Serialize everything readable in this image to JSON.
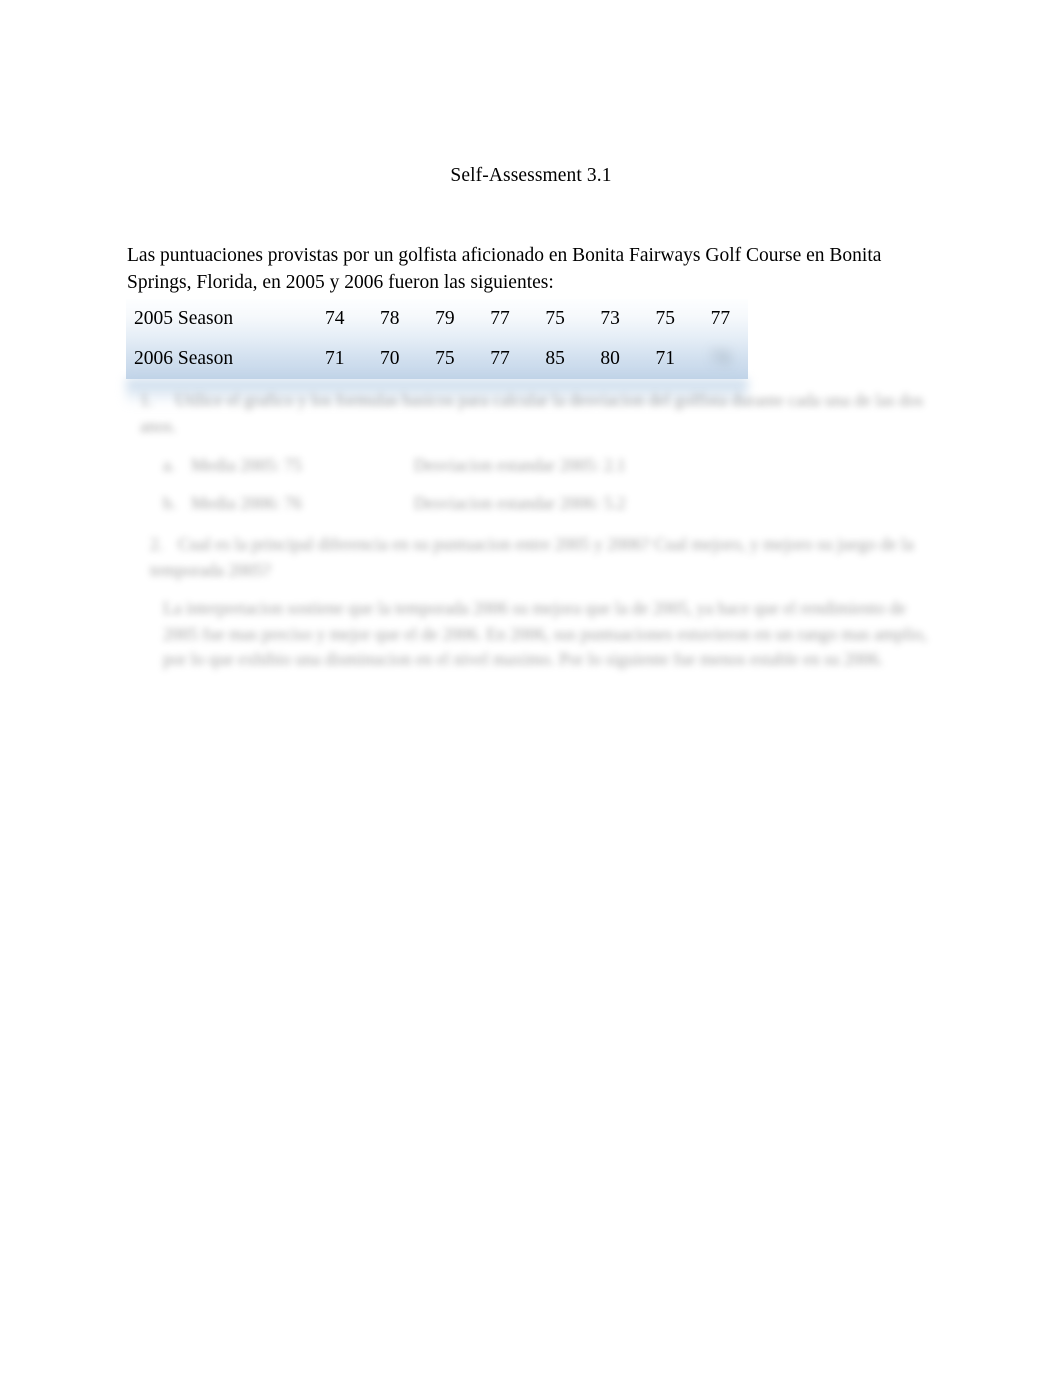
{
  "document": {
    "title": "Self-Assessment 3.1",
    "intro": "Las puntuaciones provistas por un golfista aficionado en Bonita Fairways Golf Course en Bonita Springs, Florida, en 2005 y 2006 fueron las siguientes:"
  },
  "table": {
    "rows": [
      {
        "label": "2005 Season",
        "values": [
          "74",
          "78",
          "79",
          "77",
          "75",
          "73",
          "75",
          "77"
        ]
      },
      {
        "label": "2006 Season",
        "values": [
          "71",
          "70",
          "75",
          "77",
          "85",
          "80",
          "71",
          "78"
        ]
      }
    ]
  },
  "questions": {
    "q1_marker": "1.",
    "q1_text": "Utilice el grafico y los formulas basicos para calcular la desviacion del golfista durante cada una de las dos anos.",
    "a_marker": "a.",
    "a_left": "Media 2005: 75",
    "a_right": "Desviacion estandar 2005: 2.1",
    "b_marker": "b.",
    "b_left": "Media 2006: 76",
    "b_right": "Desviacion estandar 2006: 5.2",
    "q2_marker": "2.",
    "q2_text": "Cual es la principal diferencia en su puntuacion entre 2005 y 2006? Cual mejoro, y mejoro su juego de la temporada 2005?",
    "answer": "La interpretacion sostiene que la temporada 2006 su mejora que la de 2005, ya hace que el rendimiento de 2005 fue mas preciso y mejor que el de 2006. En 2006, sus puntuaciones estuvieron en un rango mas amplio, por lo que exhibio una disminucion en el nivel maximo. Por lo siguiente fue menos estable en su 2006."
  },
  "colors": {
    "table_top": "#fdfeff",
    "table_bottom": "#c3d5e9",
    "text": "#000000"
  }
}
